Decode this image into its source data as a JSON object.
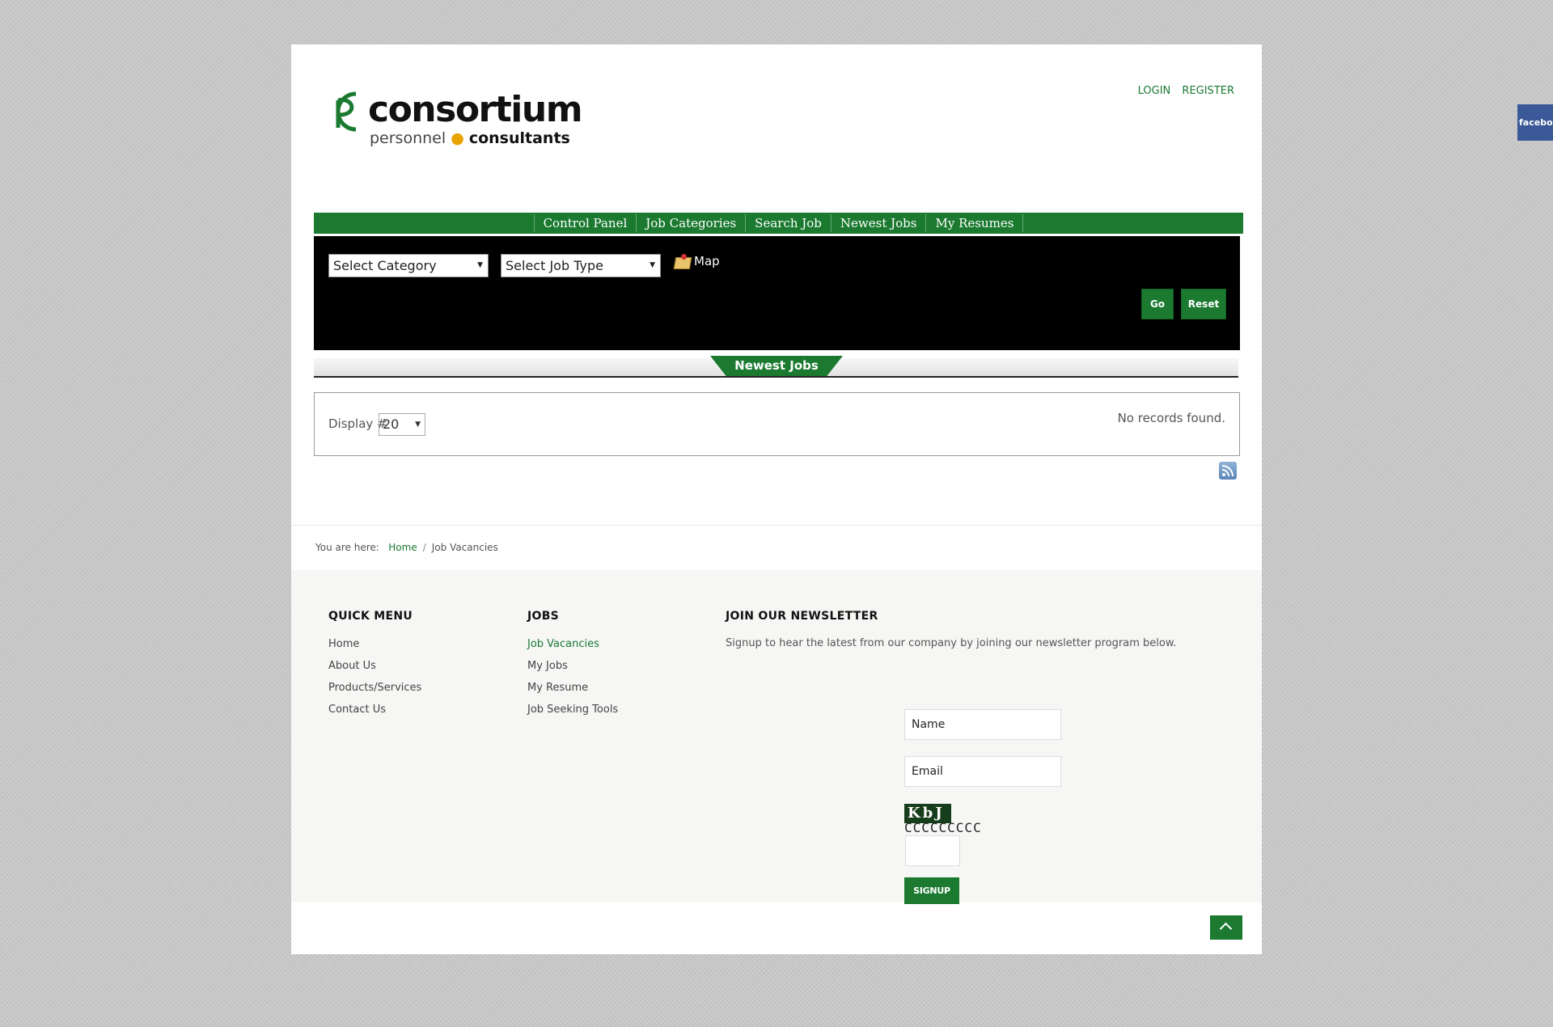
{
  "header": {
    "logo_word1": "consortium",
    "logo_word2a": "personnel",
    "logo_word2b": "consultants",
    "login": "LOGIN",
    "register": "REGISTER"
  },
  "nav": {
    "items": [
      "Control Panel",
      "Job Categories",
      "Search Job",
      "Newest Jobs",
      "My Resumes"
    ]
  },
  "search": {
    "category_select": "Select Category",
    "jobtype_select": "Select Job Type",
    "map_label": "Map",
    "go_label": "Go",
    "reset_label": "Reset"
  },
  "newest_jobs": {
    "tab_label": "Newest Jobs",
    "display_label": "Display #",
    "display_value": "20",
    "no_records": "No records found."
  },
  "breadcrumb": {
    "prefix": "You are here:",
    "home": "Home",
    "separator": "/",
    "current": "Job Vacancies"
  },
  "footer": {
    "quick_menu": {
      "heading": "QUICK MENU",
      "items": [
        "Home",
        "About Us",
        "Products/Services",
        "Contact Us"
      ]
    },
    "jobs": {
      "heading": "JOBS",
      "items": [
        "Job Vacancies",
        "My Jobs",
        "My Resume",
        "Job Seeking Tools"
      ]
    },
    "newsletter": {
      "heading": "JOIN OUR NEWSLETTER",
      "text": "Signup to hear the latest from our company by joining our newsletter program below.",
      "name_placeholder": "Name",
      "email_placeholder": "Email",
      "captcha_text": "KbJ",
      "captcha_row": "CCCCCCCCC",
      "signup_label": "SIGNUP"
    }
  },
  "social": {
    "facebook": "facebook"
  },
  "colors": {
    "brand_green": "#1b7a30",
    "panel_black": "#000000",
    "facebook_blue": "#3b5998"
  },
  "icons": [
    "map-icon",
    "dropdown-arrow-icon",
    "rss-icon",
    "chevron-up-icon"
  ]
}
